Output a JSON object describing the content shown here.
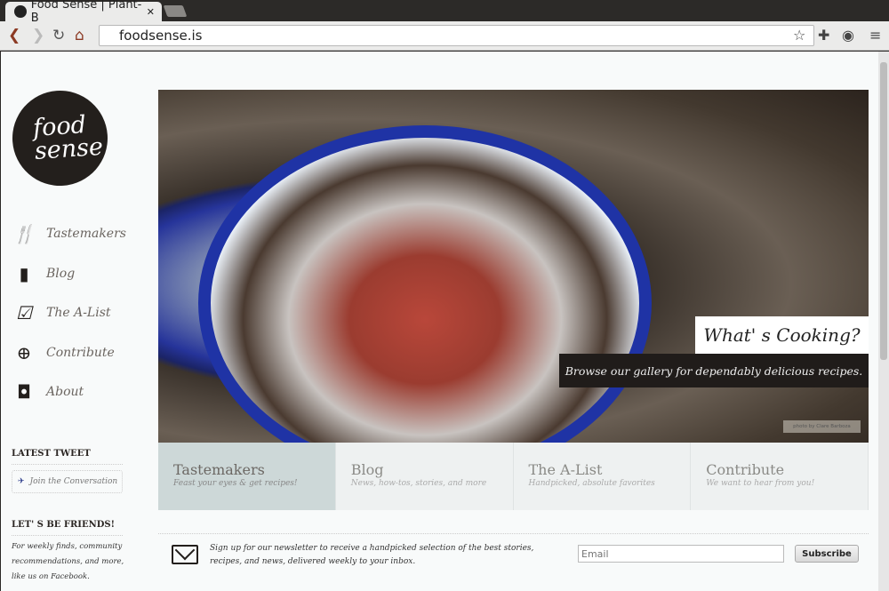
{
  "browser": {
    "tab_title": "Food Sense | Plant-B",
    "url": "foodsense.is"
  },
  "logo": {
    "line1": "food",
    "line2": "sense"
  },
  "nav": [
    {
      "label": "Tastemakers",
      "icon": "utensils-icon"
    },
    {
      "label": "Blog",
      "icon": "book-icon"
    },
    {
      "label": "The A-List",
      "icon": "clipboard-check-icon"
    },
    {
      "label": "Contribute",
      "icon": "camera-icon"
    },
    {
      "label": "About",
      "icon": "profile-book-icon"
    }
  ],
  "sidebar": {
    "latest_tweet": "LATEST TWEET",
    "tweet_button": "Join the Conversation",
    "friends_heading": "LET' S BE FRIENDS!",
    "friends_text": "For weekly finds, community recommendations, and more, like us on Facebook."
  },
  "hero": {
    "title": "What' s Cooking?",
    "subtitle": "Browse our gallery for dependably delicious recipes.",
    "credit": "photo by Clare Barboza"
  },
  "tiles": [
    {
      "title": "Tastemakers",
      "subtitle": "Feast your eyes & get recipes!"
    },
    {
      "title": "Blog",
      "subtitle": "News, how-tos, stories, and more"
    },
    {
      "title": "The A-List",
      "subtitle": "Handpicked, absolute favorites"
    },
    {
      "title": "Contribute",
      "subtitle": "We want to hear from you!"
    }
  ],
  "newsletter": {
    "text": "Sign up for our newsletter to receive a handpicked selection of the best stories, recipes, and news, delivered weekly to your inbox.",
    "email_placeholder": "Email",
    "subscribe": "Subscribe"
  }
}
